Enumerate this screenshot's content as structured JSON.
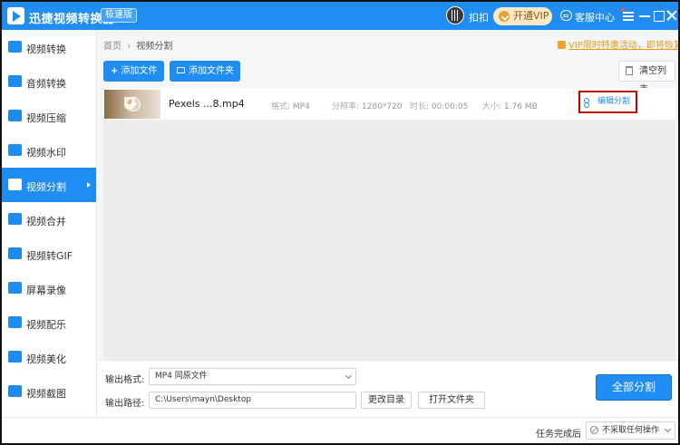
{
  "app": {
    "title": "迅捷视频转换器",
    "edition": "极速版",
    "username": "扣扣",
    "vip_label": "开通VIP",
    "service_label": "客服中心"
  },
  "sidebar": {
    "items": [
      {
        "label": "视频转换"
      },
      {
        "label": "音频转换"
      },
      {
        "label": "视频压缩"
      },
      {
        "label": "视频水印"
      },
      {
        "label": "视频分割",
        "active": true
      },
      {
        "label": "视频合并"
      },
      {
        "label": "视频转GIF"
      },
      {
        "label": "屏幕录像"
      },
      {
        "label": "视频配乐"
      },
      {
        "label": "视频美化"
      },
      {
        "label": "视频截图"
      }
    ]
  },
  "breadcrumb": {
    "home": "首页",
    "separator": "›",
    "current": "视频分割"
  },
  "promo": {
    "text": "VIP限时特惠活动，即将恢复原价"
  },
  "toolbar": {
    "add_file": "添加文件",
    "add_folder": "添加文件夹",
    "clear_list": "清空列表"
  },
  "files": [
    {
      "name": "Pexels ...8.mp4",
      "format_label": "格式:",
      "format": "MP4",
      "resolution_label": "分辨率:",
      "resolution": "1280*720",
      "duration_label": "时长:",
      "duration": "00:00:05",
      "size_label": "大小:",
      "size": "1.76 MB",
      "action_label": "编辑分割"
    }
  ],
  "output": {
    "format_label": "输出格式:",
    "format_value": "MP4  同原文件",
    "path_label": "输出路径:",
    "path_value": "C:\\Users\\mayn\\Desktop",
    "change_dir": "更改目录",
    "open_folder": "打开文件夹",
    "split_all": "全部分割"
  },
  "status": {
    "after_label": "任务完成后",
    "after_value": "不采取任何操作"
  },
  "colors": {
    "primary": "#1f8df2",
    "highlight_border": "#c00000",
    "vip": "#fde9c4",
    "promo": "#e69a1a"
  }
}
